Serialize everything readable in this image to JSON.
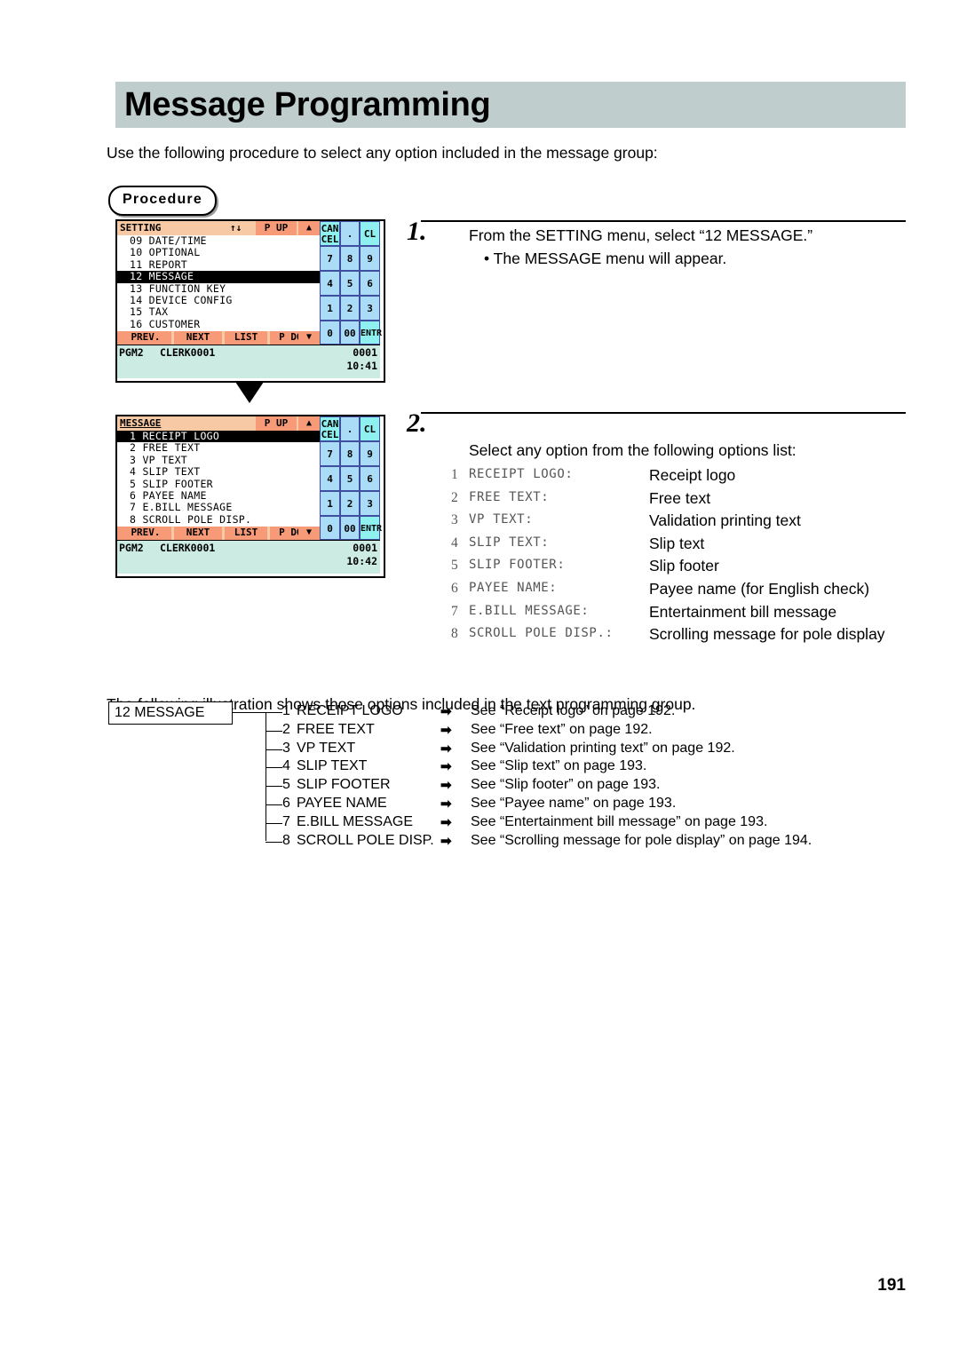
{
  "page": {
    "title": "Message Programming",
    "intro": "Use the following procedure to select any option included in the message group:",
    "procedure_badge": "Procedure",
    "illustration_note": "The following illustration shows those options included in the text programming group.",
    "page_number": "191",
    "colors": {
      "title_band": "#bfcdcd",
      "lcd_header": "#f7c9a4",
      "lcd_accent": "#f79a78",
      "keypad_bg": "#aadcf7",
      "keypad_special": "#8ff0f0",
      "status_bar": "#ccece3"
    }
  },
  "steps": [
    {
      "number": "1.",
      "line1": "From the SETTING menu, select “12 MESSAGE.”",
      "line2": "• The MESSAGE menu will appear."
    },
    {
      "number": "2.",
      "line1": "Select any option from the following options list:",
      "line2": ""
    }
  ],
  "lcd_setting": {
    "title": "SETTING",
    "title_arrows": "↑↓",
    "page_up_label": "P UP",
    "up_arrow": "▲",
    "down_arrow": "▼",
    "menu_items": [
      {
        "label": "09 DATE/TIME",
        "selected": false
      },
      {
        "label": "10 OPTIONAL",
        "selected": false
      },
      {
        "label": "11 REPORT",
        "selected": false
      },
      {
        "label": "12 MESSAGE",
        "selected": true
      },
      {
        "label": "13 FUNCTION KEY",
        "selected": false
      },
      {
        "label": "14 DEVICE CONFIG",
        "selected": false
      },
      {
        "label": "15 TAX",
        "selected": false
      },
      {
        "label": "16 CUSTOMER",
        "selected": false
      }
    ],
    "softkeys": [
      "PREV.",
      "NEXT",
      "LIST",
      "P DOWN"
    ],
    "status": {
      "mode": "PGM2",
      "clerk": "CLERK0001",
      "number": "0001",
      "time": "10:41"
    },
    "keypad": [
      "CAN CEL",
      ".",
      "CL",
      "7",
      "8",
      "9",
      "4",
      "5",
      "6",
      "1",
      "2",
      "3",
      "0",
      "00",
      "ENTR"
    ]
  },
  "lcd_message": {
    "title": "MESSAGE",
    "page_up_label": "P UP",
    "up_arrow": "▲",
    "down_arrow": "▼",
    "menu_items": [
      {
        "label": "1 RECEIPT LOGO",
        "selected": true
      },
      {
        "label": "2 FREE TEXT",
        "selected": false
      },
      {
        "label": "3 VP TEXT",
        "selected": false
      },
      {
        "label": "4 SLIP TEXT",
        "selected": false
      },
      {
        "label": "5 SLIP FOOTER",
        "selected": false
      },
      {
        "label": "6 PAYEE NAME",
        "selected": false
      },
      {
        "label": "7 E.BILL MESSAGE",
        "selected": false
      },
      {
        "label": "8 SCROLL POLE DISP.",
        "selected": false
      }
    ],
    "softkeys": [
      "PREV.",
      "NEXT",
      "LIST",
      "P DOWN"
    ],
    "status": {
      "mode": "PGM2",
      "clerk": "CLERK0001",
      "number": "0001",
      "time": "10:42"
    },
    "keypad": [
      "CAN CEL",
      ".",
      "CL",
      "7",
      "8",
      "9",
      "4",
      "5",
      "6",
      "1",
      "2",
      "3",
      "0",
      "00",
      "ENTR"
    ]
  },
  "options_list": [
    {
      "index": "1",
      "code": "RECEIPT LOGO:",
      "desc": "Receipt logo"
    },
    {
      "index": "2",
      "code": "FREE TEXT:",
      "desc": "Free text"
    },
    {
      "index": "3",
      "code": "VP TEXT:",
      "desc": "Validation printing text"
    },
    {
      "index": "4",
      "code": "SLIP TEXT:",
      "desc": "Slip text"
    },
    {
      "index": "5",
      "code": "SLIP FOOTER:",
      "desc": "Slip footer"
    },
    {
      "index": "6",
      "code": "PAYEE NAME:",
      "desc": "Payee name (for English check)"
    },
    {
      "index": "7",
      "code": "E.BILL MESSAGE:",
      "desc": "Entertainment bill message"
    },
    {
      "index": "8",
      "code": "SCROLL POLE DISP.:",
      "desc": "Scrolling message for pole display"
    }
  ],
  "tree": {
    "root": "12 MESSAGE",
    "arrow": "➡",
    "rows": [
      {
        "index": "1",
        "label": "RECEIPT LOGO",
        "see": "See “Receipt logo” on page 192."
      },
      {
        "index": "2",
        "label": "FREE TEXT",
        "see": "See “Free text” on page 192."
      },
      {
        "index": "3",
        "label": "VP TEXT",
        "see": "See “Validation printing text” on page 192."
      },
      {
        "index": "4",
        "label": "SLIP TEXT",
        "see": "See “Slip text” on page 193."
      },
      {
        "index": "5",
        "label": "SLIP FOOTER",
        "see": "See “Slip footer” on page 193."
      },
      {
        "index": "6",
        "label": "PAYEE NAME",
        "see": "See “Payee name” on page 193."
      },
      {
        "index": "7",
        "label": "E.BILL MESSAGE",
        "see": "See “Entertainment bill message” on page 193."
      },
      {
        "index": "8",
        "label": "SCROLL POLE DISP.",
        "see": " See “Scrolling message for pole display” on page 194."
      }
    ]
  }
}
